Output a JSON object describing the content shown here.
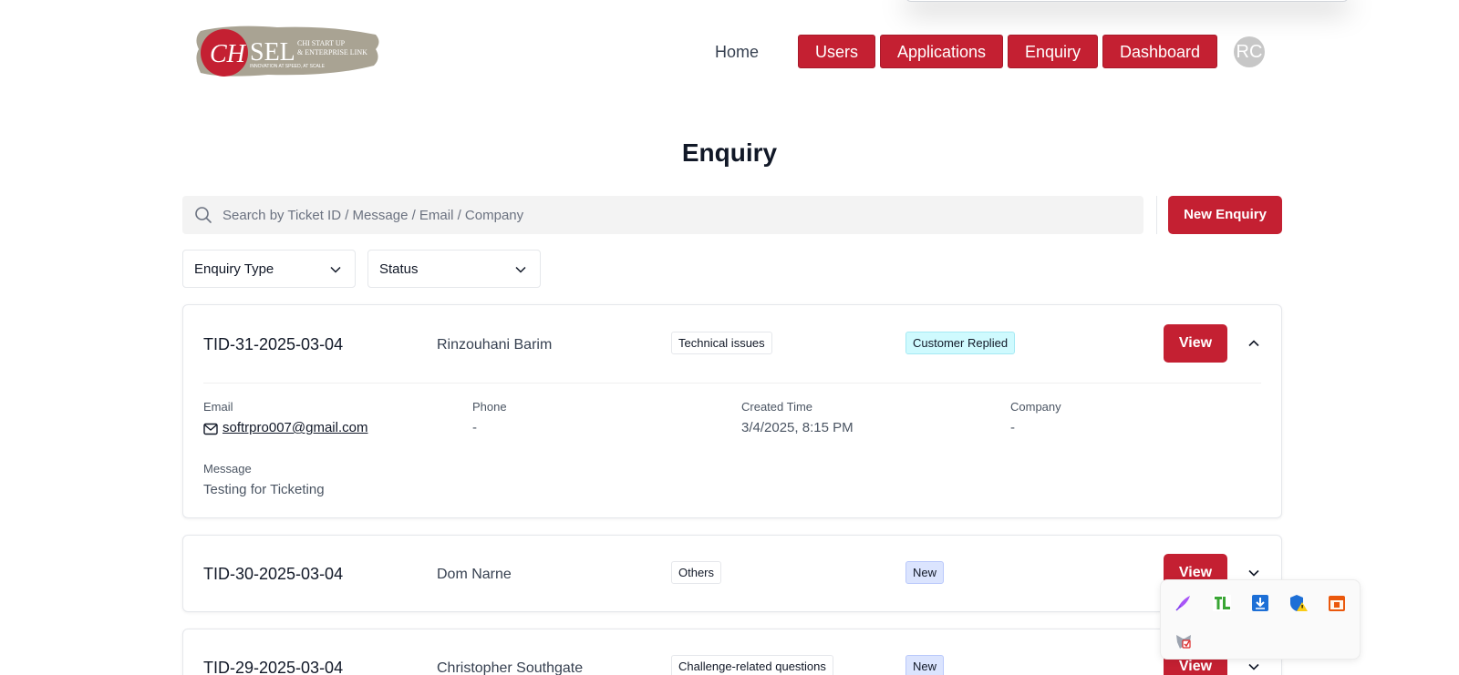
{
  "header": {
    "logo": {
      "mark": "CH",
      "wordmark": "SEL",
      "line1": "CHI START UP",
      "line2": "& ENTERPRISE LINK",
      "tagline": "INNOVATION AT SPEED, AT SCALE",
      "colors": {
        "brush": "#a9a393",
        "circle": "#c42032"
      }
    },
    "nav": {
      "home": "Home",
      "users": "Users",
      "applications": "Applications",
      "enquiry": "Enquiry",
      "dashboard": "Dashboard"
    },
    "avatar_initials": "RC"
  },
  "page": {
    "title": "Enquiry"
  },
  "search": {
    "placeholder": "Search by Ticket ID / Message / Email / Company"
  },
  "new_enquiry_label": "New Enquiry",
  "filters": {
    "type_label": "Enquiry Type",
    "status_label": "Status"
  },
  "labels": {
    "email": "Email",
    "phone": "Phone",
    "created_time": "Created Time",
    "company": "Company",
    "message": "Message",
    "view": "View"
  },
  "enquiries": [
    {
      "ticket_id": "TID-31-2025-03-04",
      "name": "Rinzouhani Barim",
      "type": "Technical issues",
      "status": "Customer Replied",
      "expanded": true,
      "email": "softrpro007@gmail.com",
      "phone": "-",
      "created_time": "3/4/2025, 8:15 PM",
      "company": "-",
      "message": "Testing for Ticketing"
    },
    {
      "ticket_id": "TID-30-2025-03-04",
      "name": "Dom Narne",
      "type": "Others",
      "status": "New",
      "expanded": false
    },
    {
      "ticket_id": "TID-29-2025-03-04",
      "name": "Christopher Southgate",
      "type": "Challenge-related questions",
      "status": "New",
      "expanded": false
    }
  ],
  "colors": {
    "primary": "#c42032",
    "status_replied_bg": "#cffafe",
    "status_new_bg": "#dbe4fe"
  },
  "extension_tray": {
    "icons": [
      "quill-icon",
      "tl-icon",
      "download-icon",
      "shield-warning-icon",
      "calendar-icon",
      "metamask-icon"
    ]
  }
}
